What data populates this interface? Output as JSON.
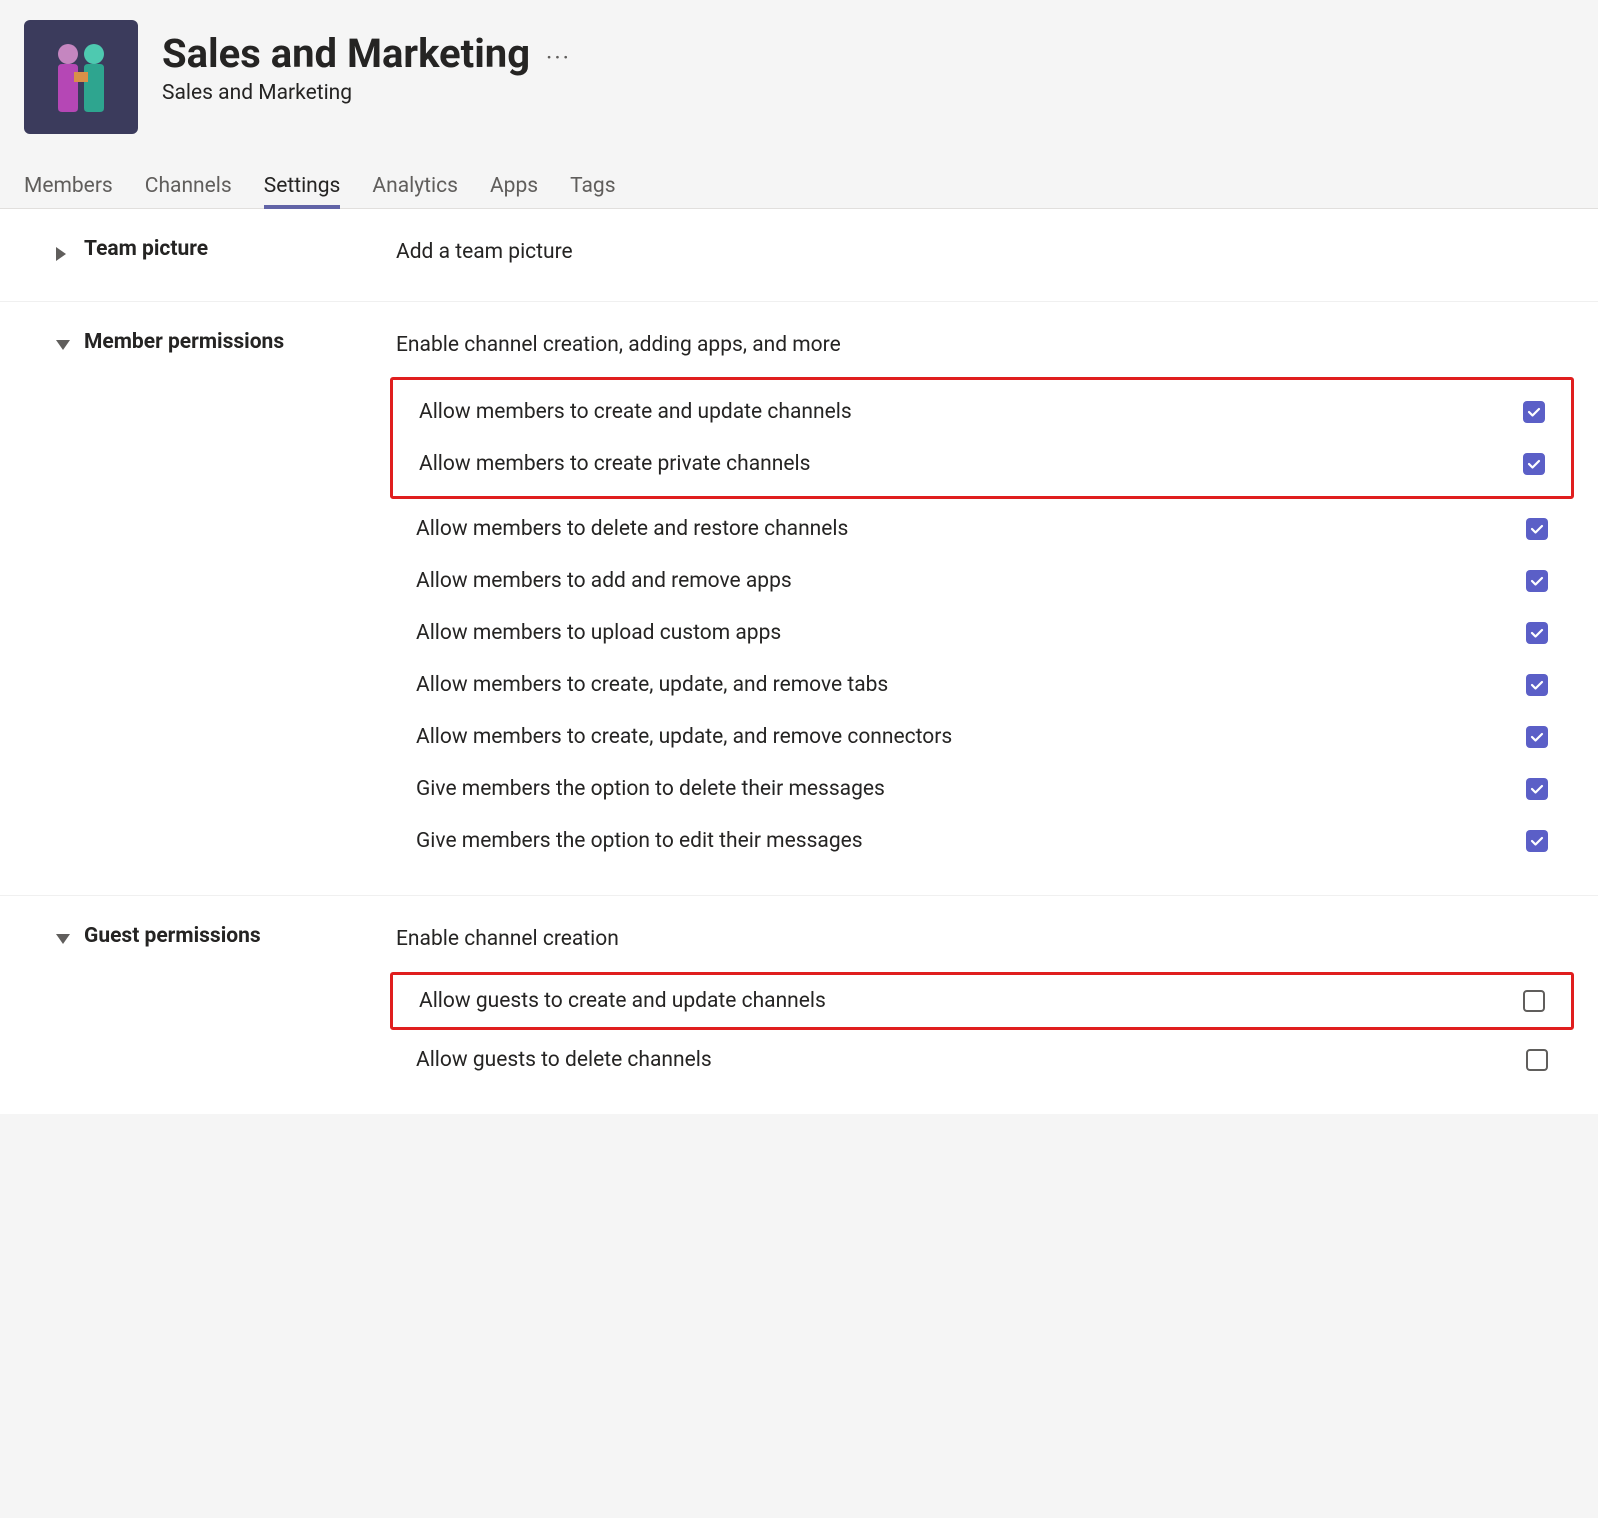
{
  "header": {
    "title": "Sales and Marketing",
    "subtitle": "Sales and Marketing"
  },
  "tabs": [
    {
      "label": "Members",
      "active": false
    },
    {
      "label": "Channels",
      "active": false
    },
    {
      "label": "Settings",
      "active": true
    },
    {
      "label": "Analytics",
      "active": false
    },
    {
      "label": "Apps",
      "active": false
    },
    {
      "label": "Tags",
      "active": false
    }
  ],
  "sections": {
    "teamPicture": {
      "title": "Team picture",
      "desc": "Add a team picture"
    },
    "memberPermissions": {
      "title": "Member permissions",
      "desc": "Enable channel creation, adding apps, and more",
      "items": [
        {
          "label": "Allow members to create and update channels",
          "checked": true
        },
        {
          "label": "Allow members to create private channels",
          "checked": true
        },
        {
          "label": "Allow members to delete and restore channels",
          "checked": true
        },
        {
          "label": "Allow members to add and remove apps",
          "checked": true
        },
        {
          "label": "Allow members to upload custom apps",
          "checked": true
        },
        {
          "label": "Allow members to create, update, and remove tabs",
          "checked": true
        },
        {
          "label": "Allow members to create, update, and remove connectors",
          "checked": true
        },
        {
          "label": "Give members the option to delete their messages",
          "checked": true
        },
        {
          "label": "Give members the option to edit their messages",
          "checked": true
        }
      ]
    },
    "guestPermissions": {
      "title": "Guest permissions",
      "desc": "Enable channel creation",
      "items": [
        {
          "label": "Allow guests to create and update channels",
          "checked": false
        },
        {
          "label": "Allow guests to delete channels",
          "checked": false
        }
      ]
    }
  }
}
